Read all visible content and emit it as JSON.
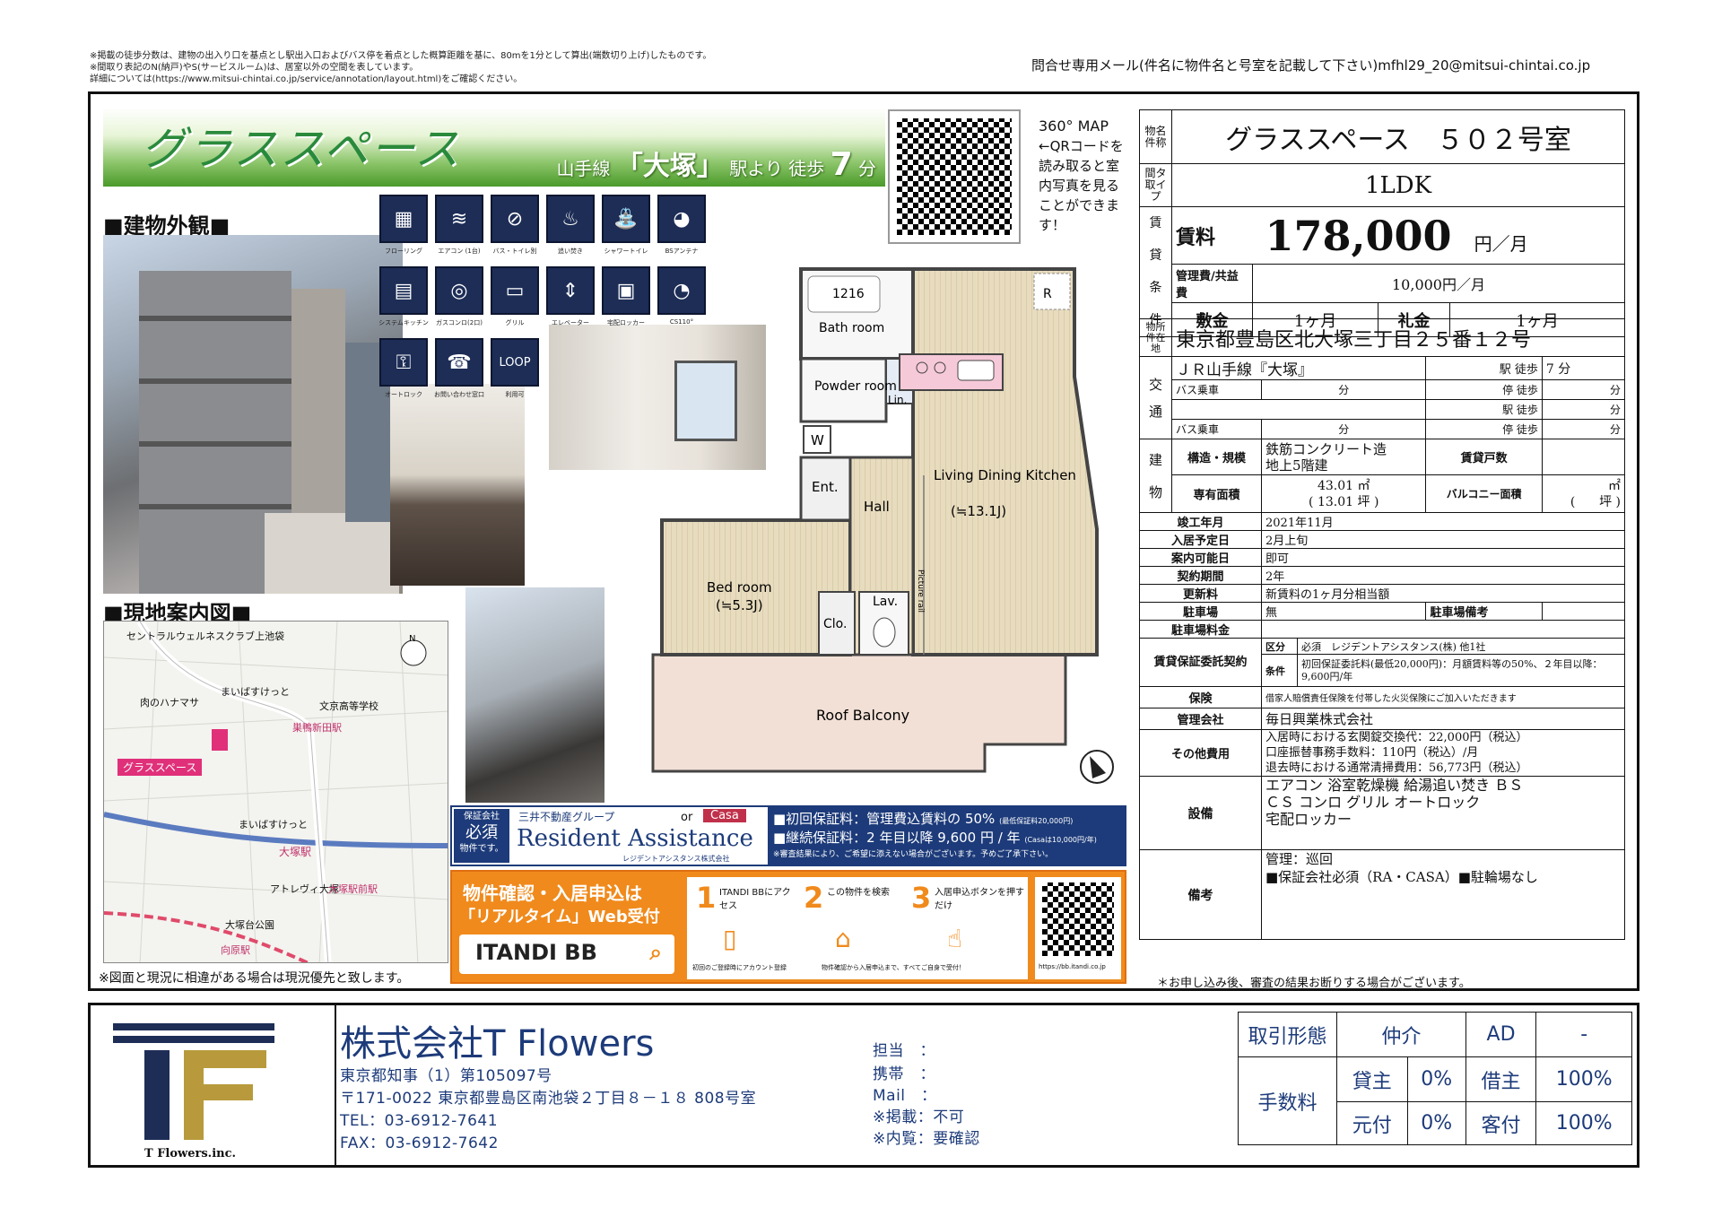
{
  "notes": [
    "※掲載の徒歩分数は、建物の出入り口を基点とし駅出入口およびバス停を着点とした概算距離を基に、80mを1分として算出(端数切り上げ)したものです。",
    "※間取り表記のN(納戸)やS(サービスルーム)は、居室以外の空間を表しています。",
    "詳細については(https://www.mitsui-chintai.co.jp/service/annotation/layout.html)をご確認ください。"
  ],
  "contact_mail": "問合せ専用メール(件名に物件名と号室を記載して下さい)mfhl29_20@mitsui-chintai.co.jp",
  "banner": {
    "name": "グラススペース",
    "line": "山手線",
    "station": "「大塚」",
    "walk_prefix": "駅より 徒歩",
    "walk_min": "7",
    "walk_unit": "分"
  },
  "sections": {
    "exterior": "■建物外観■",
    "map": "■現地案内図■"
  },
  "icons": [
    {
      "name": "flooring-icon",
      "glyph": "▦",
      "label": "フローリング"
    },
    {
      "name": "aircon-icon",
      "glyph": "≋",
      "label": "エアコン (1台)"
    },
    {
      "name": "bath-toilet-icon",
      "glyph": "⊘",
      "label": "バス・トイレ別"
    },
    {
      "name": "reheat-bath-icon",
      "glyph": "♨",
      "label": "追い焚き"
    },
    {
      "name": "shower-toilet-icon",
      "glyph": "⛲",
      "label": "シャワートイレ"
    },
    {
      "name": "bs-antenna-icon",
      "glyph": "◕",
      "label": "BSアンテナ"
    },
    {
      "name": "system-kitchen-icon",
      "glyph": "▤",
      "label": "システムキッチン"
    },
    {
      "name": "gas-stove-icon",
      "glyph": "◎",
      "label": "ガスコンロ(2口)"
    },
    {
      "name": "grill-icon",
      "glyph": "▭",
      "label": "グリル"
    },
    {
      "name": "elevator-icon",
      "glyph": "⇕",
      "label": "エレベーター"
    },
    {
      "name": "delivery-locker-icon",
      "glyph": "▣",
      "label": "宅配ロッカー"
    },
    {
      "name": "cs110-icon",
      "glyph": "◔",
      "label": "CS110°"
    },
    {
      "name": "autolock-icon",
      "glyph": "⚿",
      "label": "オートロック"
    },
    {
      "name": "support-24h-icon",
      "glyph": "☎",
      "label": "お問い合わせ窓口"
    },
    {
      "name": "loop-icon",
      "glyph": "LOOP",
      "label": "利用可"
    }
  ],
  "qr_text": {
    "title": "360° MAP",
    "body": "←QRコードを読み取ると室内写真を見ることができます！"
  },
  "floorplan": {
    "bath": "1216",
    "bathroom": "Bath room",
    "powder": "Powder room",
    "lin": "Lin.",
    "w": "W",
    "ent": "Ent.",
    "hall": "Hall",
    "ldk": "Living Dining Kitchen",
    "ldk_size": "(≒13.1J)",
    "bed": "Bed room",
    "bed_size": "(≒5.3J)",
    "clo": "Clo.",
    "lav": "Lav.",
    "picture_rail": "Picture rail",
    "r": "R",
    "balcony": "Roof Balcony"
  },
  "map_labels": [
    "セントラルウェルネスクラブ上池袋",
    "肉のハナマサ",
    "まいばすけっと",
    "文京高等学校",
    "巣鴨新田駅",
    "グラススペース",
    "まいばすけっと",
    "大塚駅",
    "アトレヴィ大塚",
    "大塚駅前駅",
    "大塚台公園",
    "向原駅"
  ],
  "map_note": "※図面と現況に相違がある場合は現況優先と致します。",
  "ra_ad": {
    "badge_top": "保証会社",
    "badge_mid": "必須",
    "badge_bot": "物件です。",
    "group": "三井不動産グループ",
    "or": "or",
    "casa": "Casa",
    "brand": "Resident Assistance",
    "brand_sub": "レジデントアシスタンス株式会社",
    "line1": "■初回保証料：管理費込賃料の 50%",
    "line1_note": "(最低保証料20,000円)",
    "line2": "■継続保証料：2 年目以降 9,600 円 / 年",
    "line2_note": "(Casaは10,000円/年)",
    "line3": "※審査結果により、ご希望に添えない場合がございます。予めご了承下さい。"
  },
  "itandi_ad": {
    "headline": "物件確認・入居申込は",
    "headline2": "「リアルタイム」Web受付",
    "brand": "ITANDI BB",
    "steps": [
      {
        "num": "1",
        "text": "ITANDI BBにアクセス"
      },
      {
        "num": "2",
        "text": "この物件を検索"
      },
      {
        "num": "3",
        "text": "入居申込ボタンを押すだけ"
      }
    ],
    "foot1": "初回のご登録時にアカウント登録",
    "foot2": "物件確認から入居申込まで、すべてご自身で受付！",
    "url": "https://bb.itandi.co.jp"
  },
  "property": {
    "name_label": "物名件称",
    "name": "グラススペース　５０２号室",
    "type_label": "間タ取イプ",
    "type": "1LDK",
    "terms_label": "賃貸条件",
    "rent_label": "賃料",
    "rent": "178,000",
    "rent_unit": "円／月",
    "mgmt_label": "管理費/共益費",
    "mgmt": "10,000円／月",
    "deposit_label": "敷金",
    "deposit": "1ヶ月",
    "key_label": "礼金",
    "key": "1ヶ月",
    "address_label": "物所件在地",
    "address": "東京都豊島区北大塚三丁目２５番１２号",
    "transport_label": "交通",
    "line": "ＪＲ山手線『大塚』",
    "station_walk": "駅 徒歩",
    "walk": "7",
    "min": "分",
    "bus": "バス乗車",
    "stop_walk": "停 徒歩",
    "station_walk2": "駅 徒歩",
    "build_label": "建物",
    "struct_label": "構造・規模",
    "struct1": "鉄筋コンクリート造",
    "struct2": "地上5階建",
    "units_label": "賃貸戸数",
    "area_label": "専有面積",
    "area_m2": "43.01",
    "area_tsubo": "13.01",
    "m2": "㎡",
    "tsubo": "坪",
    "balcony_label": "バルコニー面積",
    "built_label": "竣工年月",
    "built": "2021年11月",
    "movein_label": "入居予定日",
    "movein": "2月上旬",
    "view_label": "案内可能日",
    "view": "即可",
    "period_label": "契約期間",
    "period": "2年",
    "renew_label": "更新料",
    "renew": "新賃料の1ヶ月分相当額",
    "parking_label": "駐車場",
    "parking": "無",
    "parking_note_label": "駐車場備考",
    "parking_fee_label": "駐車場料金",
    "guarantee_label": "賃貸保証委託契約",
    "guarantee_kubun": "区分",
    "guarantee_kubun_val": "必須　レジデントアシスタンス(株) 他1社",
    "guarantee_cond": "条件",
    "guarantee_cond_val": "初回保証委託料(最低20,000円)：月額賃料等の50%、２年目以降：9,600円/年",
    "insurance_label": "保険",
    "insurance": "借家人賠償責任保険を付帯した火災保険にご加入いただきます",
    "mgmt_co_label": "管理会社",
    "mgmt_co": "毎日興業株式会社",
    "other_label": "その他費用",
    "other1": "入居時における玄関錠交換代：22,000円（税込）",
    "other2": "口座振替事務手数料：110円（税込）/月",
    "other3": "退去時における通常清掃費用：56,773円（税込）",
    "equip_label": "設備",
    "equip1": "エアコン 浴室乾燥機 給湯追い焚き ＢＳ",
    "equip2": "ＣＳ コンロ グリル オートロック",
    "equip3": "宅配ロッカー",
    "remarks_label": "備考",
    "remarks1": "管理：巡回",
    "remarks2": "■保証会社必須（RA・CASA）■駐輪場なし",
    "bottom_note": "＊お申し込み後、審査の結果お断りする場合がございます。"
  },
  "footer": {
    "logo_text": "T Flowers.inc.",
    "company": "株式会社T Flowers",
    "license": "東京都知事（1）第105097号",
    "address": "〒171-0022 東京都豊島区南池袋２丁目８－１８ 808号室",
    "tel": "TEL：03-6912-7641",
    "fax": "FAX：03-6912-7642",
    "staff": "担当　：",
    "mobile": "携帯　：",
    "mail": "Mail　：",
    "post": "※掲載：不可",
    "preview": "※内覧：要確認"
  },
  "fee": {
    "deal_label": "取引形態",
    "deal": "仲介",
    "ad": "AD",
    "ad_val": "-",
    "fee_label": "手数料",
    "landlord": "貸主",
    "landlord_val": "0%",
    "tenant": "借主",
    "tenant_val": "100%",
    "motozuke": "元付",
    "motozuke_val": "0%",
    "kyakuzuke": "客付",
    "kyakuzuke_val": "100%"
  },
  "colors": {
    "navy": "#1d3b7a",
    "green": "#2a8a3c",
    "orange": "#f08a1c"
  }
}
